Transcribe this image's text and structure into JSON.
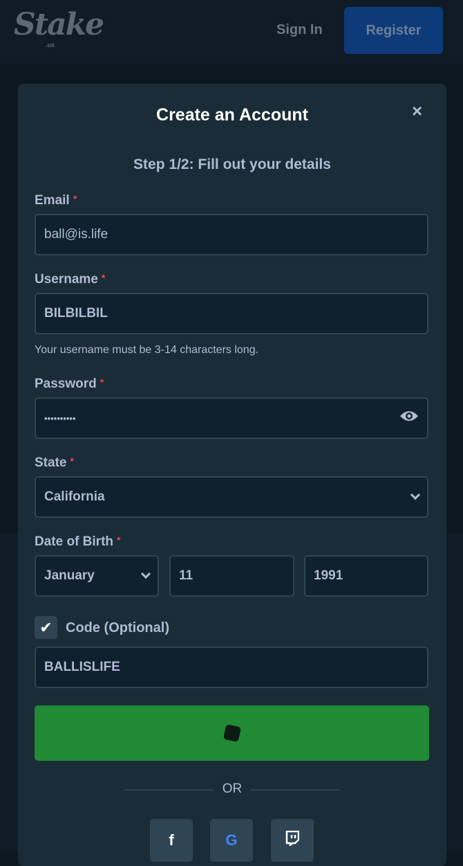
{
  "header": {
    "logo": "Stake",
    "logo_sub": ".us",
    "sign_in": "Sign In",
    "register": "Register"
  },
  "modal": {
    "title": "Create an Account",
    "close_icon": "×",
    "step": "Step 1/2: Fill out your details",
    "required_mark": "*",
    "email": {
      "label": "Email",
      "value": "ball@is.life"
    },
    "username": {
      "label": "Username",
      "value": "BILBILBIL",
      "hint": "Your username must be 3-14 characters long."
    },
    "password": {
      "label": "Password",
      "value": "••••••••••",
      "icon": "eye-icon"
    },
    "state": {
      "label": "State",
      "value": "California"
    },
    "dob": {
      "label": "Date of Birth",
      "month": "January",
      "day": "11",
      "year": "1991"
    },
    "code": {
      "label": "Code (Optional)",
      "checked": true,
      "check_glyph": "✔",
      "value": "BALLISLIFE"
    },
    "submit": {
      "icon": "dice-icon",
      "color": "#208a34"
    },
    "or": "OR",
    "social": [
      {
        "icon": "facebook-icon",
        "glyph": "f"
      },
      {
        "icon": "google-icon",
        "glyph": "G"
      },
      {
        "icon": "twitch-icon",
        "glyph": "t"
      }
    ]
  }
}
